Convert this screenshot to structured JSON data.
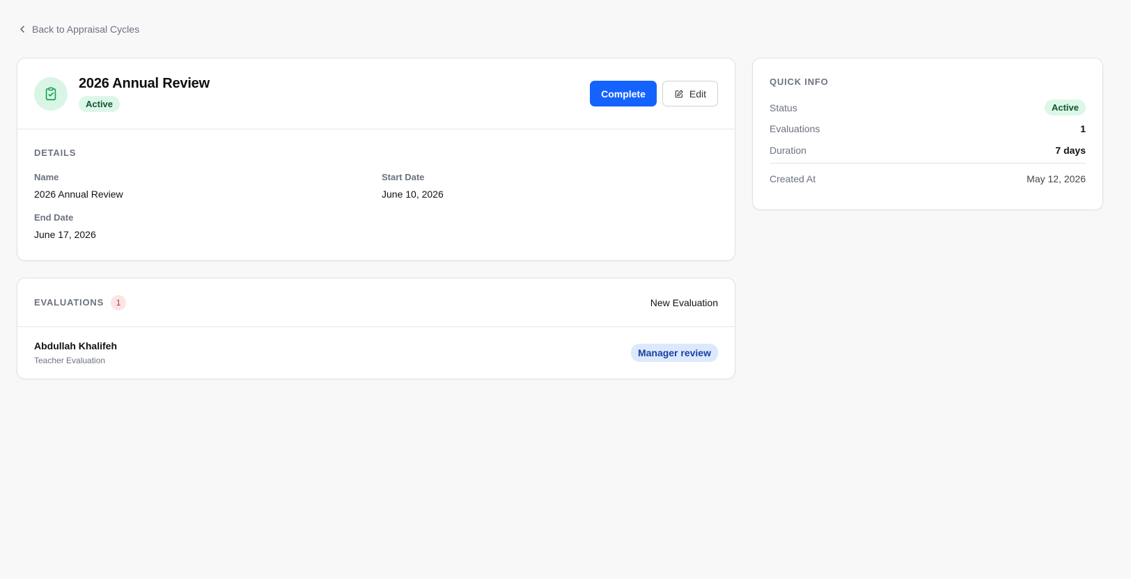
{
  "nav": {
    "back_label": "Back to Appraisal Cycles"
  },
  "cycle": {
    "title": "2026 Annual Review",
    "status": "Active",
    "actions": {
      "complete": "Complete",
      "edit": "Edit"
    }
  },
  "details": {
    "section_label": "DETAILS",
    "fields": {
      "name": {
        "label": "Name",
        "value": "2026 Annual Review"
      },
      "start_date": {
        "label": "Start Date",
        "value": "June 10, 2026"
      },
      "end_date": {
        "label": "End Date",
        "value": "June 17, 2026"
      }
    }
  },
  "evaluations": {
    "section_label": "EVALUATIONS",
    "count": "1",
    "new_label": "New Evaluation",
    "items": [
      {
        "name": "Abdullah Khalifeh",
        "type": "Teacher Evaluation",
        "status": "Manager review"
      }
    ]
  },
  "quick_info": {
    "section_label": "QUICK INFO",
    "status": {
      "label": "Status",
      "value": "Active"
    },
    "evaluations": {
      "label": "Evaluations",
      "value": "1"
    },
    "duration": {
      "label": "Duration",
      "value": "7 days"
    },
    "created_at": {
      "label": "Created At",
      "value": "May 12, 2026"
    }
  },
  "colors": {
    "primary": "#1463ff",
    "active_bg": "#dcf7e8",
    "active_text": "#14532d",
    "review_bg": "#dce9fd",
    "review_text": "#1a3fa3",
    "count_bg": "#fde4e4"
  },
  "icons": {
    "back": "chevron-left-icon",
    "cycle": "clipboard-check-icon",
    "edit": "edit-icon"
  }
}
